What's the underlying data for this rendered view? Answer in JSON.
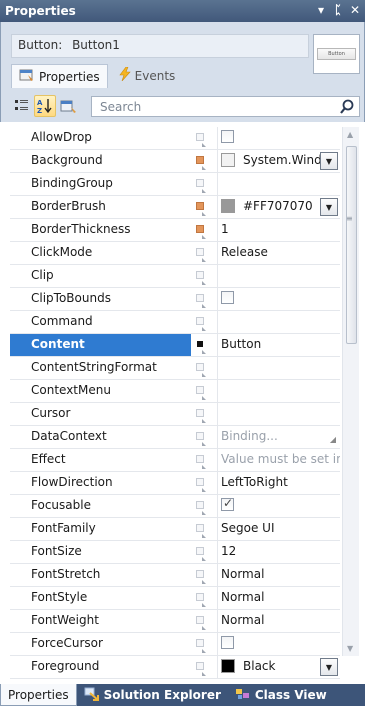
{
  "window": {
    "title": "Properties",
    "controls": [
      "▾",
      "ᛈ",
      "✕"
    ]
  },
  "header": {
    "type_label": "Button:",
    "object_name": "Button1",
    "preview_text": "Button"
  },
  "tabs": [
    {
      "label": "Properties",
      "icon": "properties-icon",
      "active": true
    },
    {
      "label": "Events",
      "icon": "lightning-icon",
      "active": false
    }
  ],
  "toolbar": {
    "search_placeholder": "Search",
    "buttons": [
      "categorized-icon",
      "sort-alpha-icon",
      "property-pages-icon"
    ]
  },
  "properties": [
    {
      "name": "AllowDrop",
      "value": "",
      "kind": "checkbox",
      "checked": false
    },
    {
      "name": "Background",
      "value": "System.Windo",
      "kind": "brush",
      "swatch": "#f2f2f2",
      "set": true
    },
    {
      "name": "BindingGroup",
      "value": "",
      "kind": "text"
    },
    {
      "name": "BorderBrush",
      "value": "#FF707070",
      "kind": "brush",
      "swatch": "#999999",
      "set": true
    },
    {
      "name": "BorderThickness",
      "value": "1",
      "kind": "text",
      "set": true
    },
    {
      "name": "ClickMode",
      "value": "Release",
      "kind": "text"
    },
    {
      "name": "Clip",
      "value": "",
      "kind": "text"
    },
    {
      "name": "ClipToBounds",
      "value": "",
      "kind": "checkbox",
      "checked": false
    },
    {
      "name": "Command",
      "value": "",
      "kind": "text"
    },
    {
      "name": "Content",
      "value": "Button",
      "kind": "text",
      "selected": true
    },
    {
      "name": "ContentStringFormat",
      "value": "",
      "kind": "text"
    },
    {
      "name": "ContextMenu",
      "value": "",
      "kind": "text"
    },
    {
      "name": "Cursor",
      "value": "",
      "kind": "text"
    },
    {
      "name": "DataContext",
      "value": "Binding...",
      "kind": "disabled"
    },
    {
      "name": "Effect",
      "value": "Value must be set in X",
      "kind": "disabled"
    },
    {
      "name": "FlowDirection",
      "value": "LeftToRight",
      "kind": "text"
    },
    {
      "name": "Focusable",
      "value": "",
      "kind": "checkbox",
      "checked": true
    },
    {
      "name": "FontFamily",
      "value": "Segoe UI",
      "kind": "text"
    },
    {
      "name": "FontSize",
      "value": "12",
      "kind": "text"
    },
    {
      "name": "FontStretch",
      "value": "Normal",
      "kind": "text"
    },
    {
      "name": "FontStyle",
      "value": "Normal",
      "kind": "text"
    },
    {
      "name": "FontWeight",
      "value": "Normal",
      "kind": "text"
    },
    {
      "name": "ForceCursor",
      "value": "",
      "kind": "checkbox",
      "checked": false
    },
    {
      "name": "Foreground",
      "value": "Black",
      "kind": "brush",
      "swatch": "#000000"
    }
  ],
  "bottom_tabs": [
    {
      "label": "Properties",
      "active": true
    },
    {
      "label": "Solution Explorer",
      "icon": "solution-explorer-icon",
      "active": false
    },
    {
      "label": "Class View",
      "icon": "class-view-icon",
      "active": false
    }
  ],
  "colors": {
    "title_bar": "#4a6386",
    "selection": "#2f7bd1",
    "local_value_marker": "#e3955a"
  }
}
